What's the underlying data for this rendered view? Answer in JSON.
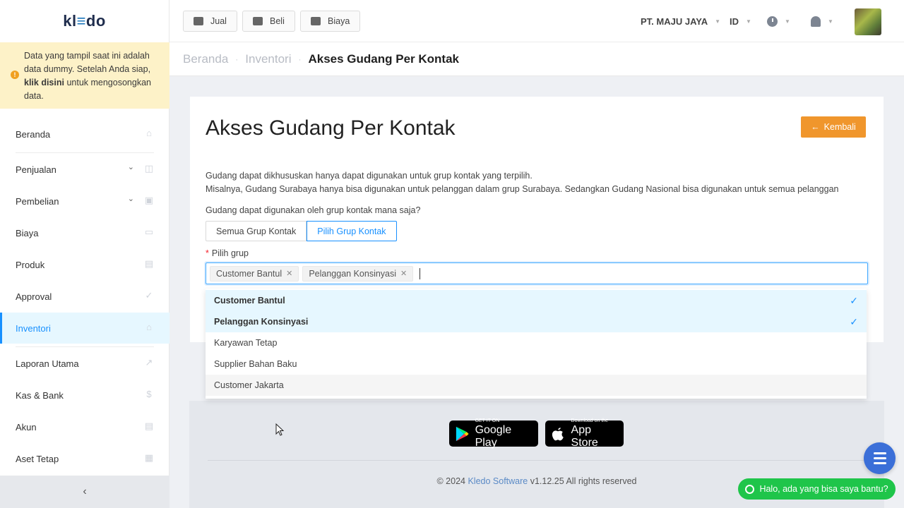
{
  "sidebar": {
    "logo": {
      "pre": "kl",
      "mid": "≡",
      "post": "do"
    },
    "notice": {
      "text_before": "Data yang tampil saat ini adalah data dummy. Setelah Anda siap, ",
      "link": "klik disini",
      "text_after": " untuk mengosongkan data."
    },
    "items": [
      {
        "label": "Beranda",
        "icon": "home-icon"
      },
      {
        "label": "Penjualan",
        "icon": "basket-icon"
      },
      {
        "label": "Pembelian",
        "icon": "bag-icon"
      },
      {
        "label": "Biaya",
        "icon": "card-icon"
      },
      {
        "label": "Produk",
        "icon": "box-icon"
      },
      {
        "label": "Approval",
        "icon": "check-icon"
      },
      {
        "label": "Inventori",
        "icon": "warehouse-icon"
      },
      {
        "label": "Laporan Utama",
        "icon": "chart-icon"
      },
      {
        "label": "Kas & Bank",
        "icon": "dollar-icon"
      },
      {
        "label": "Akun",
        "icon": "list-icon"
      },
      {
        "label": "Aset Tetap",
        "icon": "building-icon"
      }
    ],
    "collapse": "‹"
  },
  "topbar": {
    "jual": "Jual",
    "beli": "Beli",
    "biaya": "Biaya",
    "company": "PT. MAJU JAYA",
    "language": "ID"
  },
  "breadcrumb": {
    "home": "Beranda",
    "section": "Inventori",
    "current": "Akses Gudang Per Kontak",
    "sep": "·"
  },
  "page": {
    "title": "Akses Gudang Per Kontak",
    "back_button": "Kembali",
    "desc_line1": "Gudang dapat dikhususkan hanya dapat digunakan untuk grup kontak yang terpilih.",
    "desc_line2": "Misalnya, Gudang Surabaya hanya bisa digunakan untuk pelanggan dalam grup Surabaya. Sedangkan Gudang Nasional bisa digunakan untuk semua pelanggan",
    "question": "Gudang dapat digunakan oleh grup kontak mana saja?",
    "option_all": "Semua Grup Kontak",
    "option_select": "Pilih Grup Kontak",
    "group_label": "Pilih grup",
    "required_mark": "*",
    "selected_tags": [
      "Customer Bantul",
      "Pelanggan Konsinyasi"
    ]
  },
  "dropdown": {
    "options": [
      {
        "label": "Customer Bantul",
        "selected": true
      },
      {
        "label": "Pelanggan Konsinyasi",
        "selected": true
      },
      {
        "label": "Karyawan Tetap",
        "selected": false
      },
      {
        "label": "Supplier Bahan Baku",
        "selected": false
      },
      {
        "label": "Customer Jakarta",
        "selected": false
      }
    ]
  },
  "footer": {
    "google_small": "GET IT ON",
    "google_big": "Google Play",
    "apple_small": "Download on the",
    "apple_big": "App Store",
    "copyright_pre": "© 2024 ",
    "copyright_link": "Kledo Software",
    "copyright_post": " v1.12.25 All rights reserved"
  },
  "chat": {
    "label": "Halo, ada yang bisa saya bantu?"
  },
  "colors": {
    "primary": "#1890ff",
    "accent": "#f0962c",
    "chat": "#1fc54a",
    "notice_bg": "#fdf2c8"
  }
}
